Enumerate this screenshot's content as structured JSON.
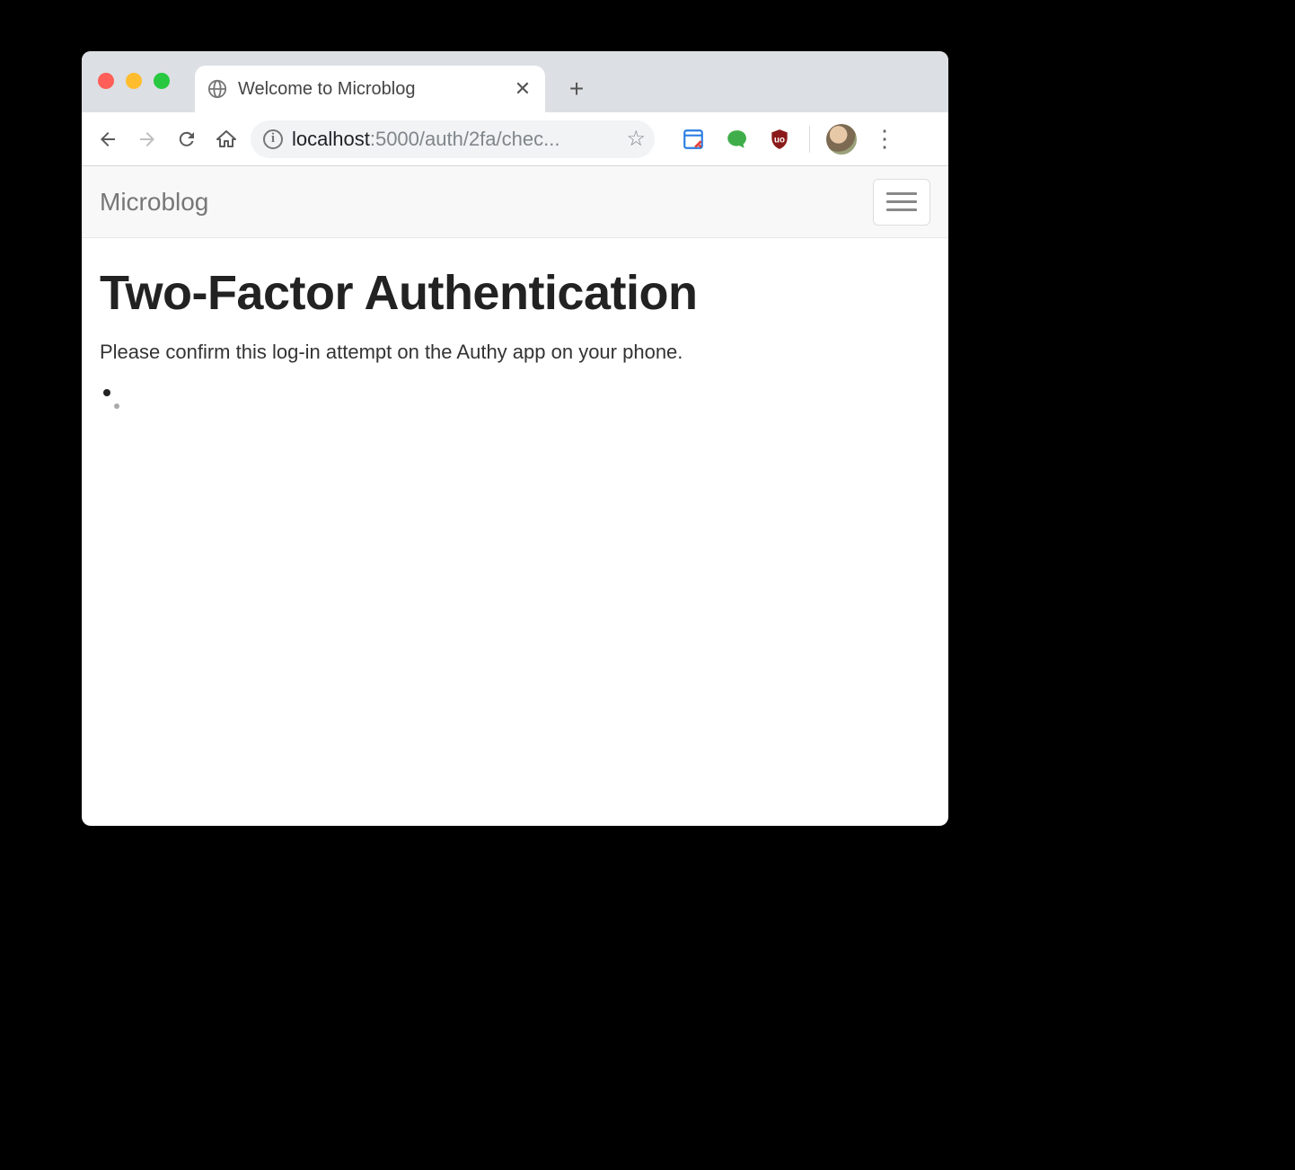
{
  "browser": {
    "tab_title": "Welcome to Microblog",
    "url_host": "localhost",
    "url_path_display": ":5000/auth/2fa/chec..."
  },
  "app": {
    "brand": "Microblog",
    "heading": "Two-Factor Authentication",
    "body_text": "Please confirm this log-in attempt on the Authy app on your phone."
  }
}
